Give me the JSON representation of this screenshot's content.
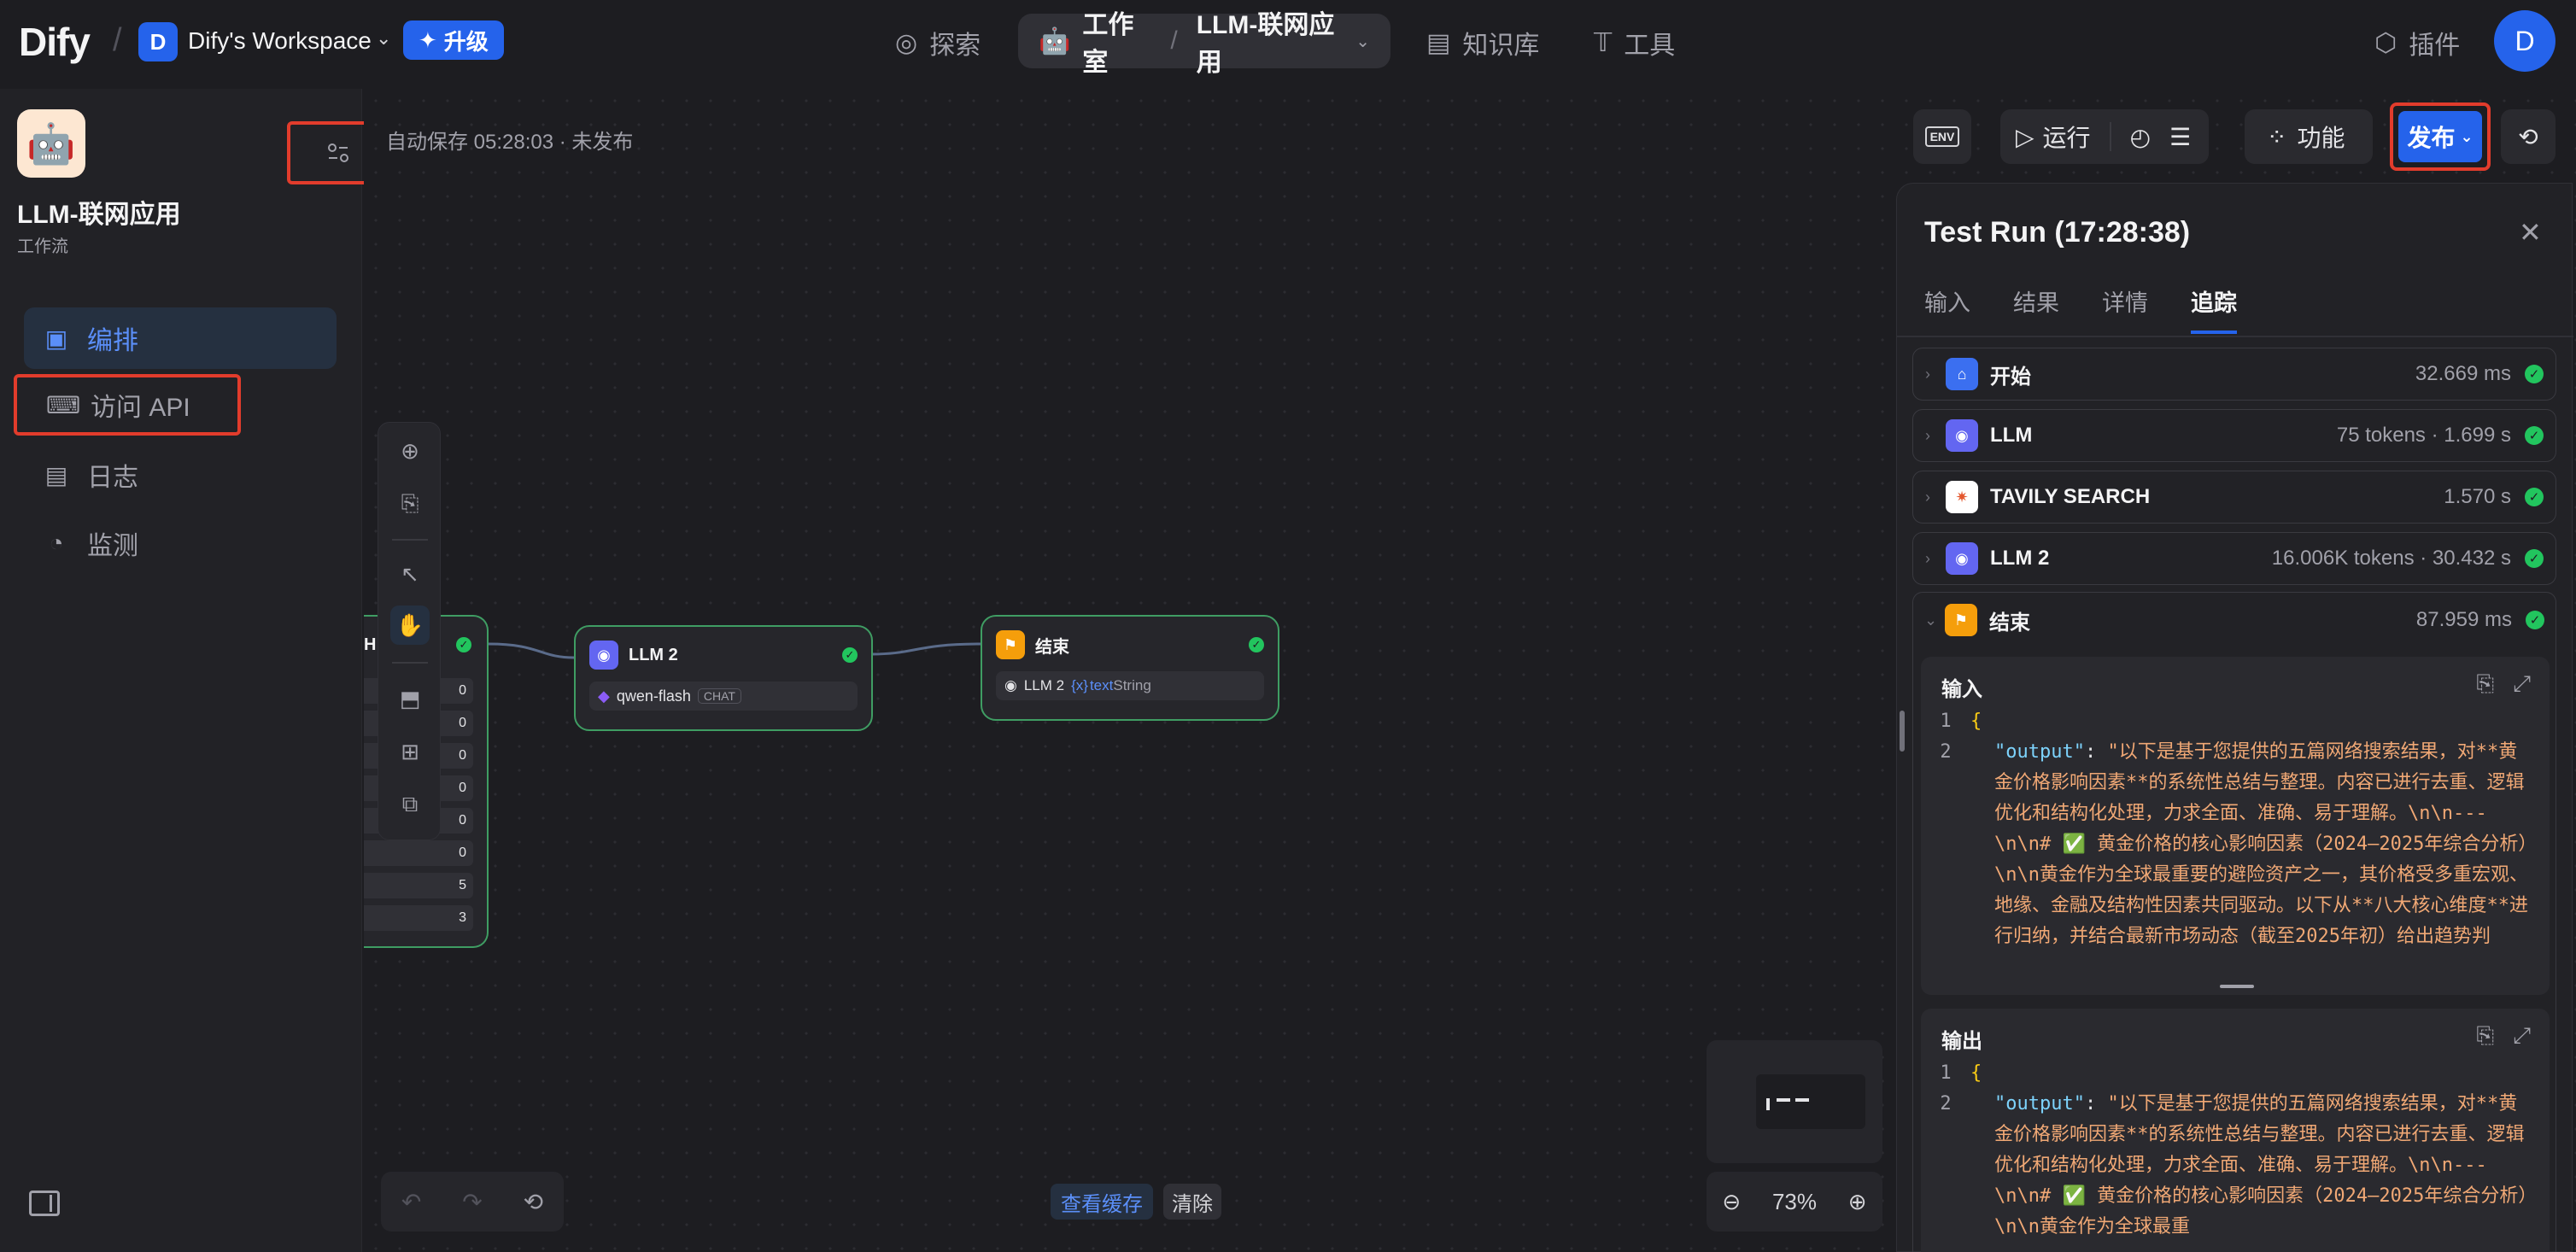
{
  "topbar": {
    "logo": "Dify",
    "workspace_initial": "D",
    "workspace_name": "Dify's Workspace",
    "upgrade_label": "升级",
    "nav_explore": "探索",
    "nav_studio": "工作室",
    "nav_app": "LLM-联网应用",
    "nav_knowledge": "知识库",
    "nav_tools": "工具",
    "nav_plugins": "插件",
    "user_initial": "D"
  },
  "sidebar": {
    "app_title": "LLM-联网应用",
    "app_type": "工作流",
    "items": [
      {
        "label": "编排",
        "icon": "layout-icon",
        "active": true
      },
      {
        "label": "访问 API",
        "icon": "terminal-icon",
        "active": false
      },
      {
        "label": "日志",
        "icon": "log-icon",
        "active": false
      },
      {
        "label": "监测",
        "icon": "gauge-icon",
        "active": false
      }
    ]
  },
  "canvas": {
    "autosave": "自动保存 05:28:03 · 未发布",
    "partial_node_letter": "H",
    "partial_node_values": [
      "0",
      "0",
      "0",
      "0",
      "0",
      "0",
      "5",
      "3"
    ],
    "llm2_node": {
      "title": "LLM 2",
      "model": "qwen-flash",
      "badge": "CHAT"
    },
    "end_node": {
      "title": "结束",
      "var_node": "LLM 2",
      "var_name": "text",
      "var_type": "String"
    },
    "view_cache": "查看缓存",
    "clear": "清除",
    "zoom": "73%"
  },
  "toolbar": {
    "env": "ENV",
    "run": "运行",
    "features": "功能",
    "publish": "发布"
  },
  "panel": {
    "title": "Test Run (17:28:38)",
    "tabs": [
      "输入",
      "结果",
      "详情",
      "追踪"
    ],
    "active_tab": "追踪",
    "trace": [
      {
        "name": "开始",
        "meta": "32.669 ms",
        "color": "#3b6ff0",
        "icon": "home-icon"
      },
      {
        "name": "LLM",
        "meta": "75 tokens · 1.699 s",
        "color": "#6366f1",
        "icon": "llm-icon"
      },
      {
        "name": "TAVILY SEARCH",
        "meta": "1.570 s",
        "color": "#ffffff",
        "icon": "tavily-icon"
      },
      {
        "name": "LLM 2",
        "meta": "16.006K tokens · 30.432 s",
        "color": "#6366f1",
        "icon": "llm-icon"
      },
      {
        "name": "结束",
        "meta": "87.959 ms",
        "color": "#f59e0b",
        "icon": "flag-icon"
      }
    ],
    "input_label": "输入",
    "output_label": "输出",
    "code_key": "\"output\"",
    "input_text": "\"以下是基于您提供的五篇网络搜索结果，对**黄金价格影响因素**的系统性总结与整理。内容已进行去重、逻辑优化和结构化处理，力求全面、准确、易于理解。\\n\\n---\\n\\n# ✅ 黄金价格的核心影响因素（2024–2025年综合分析）\\n\\n黄金作为全球最重要的避险资产之一，其价格受多重宏观、地缘、金融及结构性因素共同驱动。以下从**八大核心维度**进行归纳，并结合最新市场动态（截至2025年初）给出趋势判",
    "output_text": "\"以下是基于您提供的五篇网络搜索结果，对**黄金价格影响因素**的系统性总结与整理。内容已进行去重、逻辑优化和结构化处理，力求全面、准确、易于理解。\\n\\n---\\n\\n# ✅ 黄金价格的核心影响因素（2024–2025年综合分析）\\n\\n黄金作为全球最重"
  }
}
